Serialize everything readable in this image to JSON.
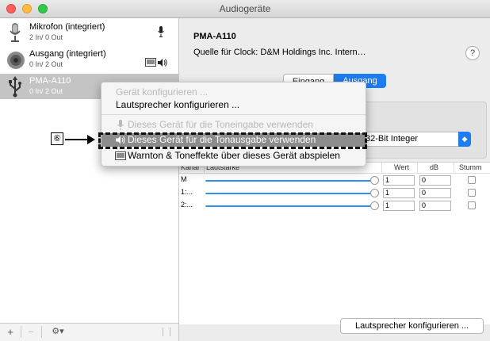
{
  "window": {
    "title": "Audiogeräte"
  },
  "sidebar": {
    "devices": [
      {
        "name": "Mikrofon (integriert)",
        "sub": "2 In/ 0 Out",
        "icon": "microphone-icon"
      },
      {
        "name": "Ausgang (integriert)",
        "sub": "0 In/ 2 Out",
        "icon": "speaker-icon"
      },
      {
        "name": "PMA-A110",
        "sub": "0 In/ 2 Out",
        "icon": "usb-icon"
      }
    ],
    "toolbar": {
      "add": "+",
      "remove": "−",
      "gear": "⚙▾"
    }
  },
  "detail": {
    "device_title": "PMA-A110",
    "clock_label": "Quelle für Clock:",
    "clock_value": "D&M Holdings Inc. Intern…",
    "help": "?",
    "tabs": {
      "input": "Eingang",
      "output": "Ausgang"
    },
    "format_value": "32-Bit Integer",
    "table": {
      "headers": {
        "channel": "Kanal",
        "volume": "Lautstärke",
        "value": "Wert",
        "db": "dB",
        "mute": "Stumm"
      },
      "rows": [
        {
          "channel": "M",
          "value": "1",
          "db": "0",
          "level": 1.0
        },
        {
          "channel": "1:...",
          "value": "1",
          "db": "0",
          "level": 1.0
        },
        {
          "channel": "2:...",
          "value": "1",
          "db": "0",
          "level": 1.0
        }
      ]
    },
    "configure_button": "Lautsprecher konfigurieren ..."
  },
  "context_menu": {
    "items": [
      {
        "label": "Gerät konfigurieren ...",
        "enabled": false
      },
      {
        "label": "Lautsprecher konfigurieren ...",
        "enabled": true
      },
      {
        "label": "Dieses Gerät für die Toneingabe verwenden",
        "enabled": false,
        "icon": "microphone-icon"
      },
      {
        "label": "Dieses Gerät für die Tonausgabe verwenden",
        "enabled": true,
        "highlighted": true,
        "icon": "speaker-icon"
      },
      {
        "label": "Warnton & Toneffekte über dieses Gerät abspielen",
        "enabled": true,
        "icon": "alert-speaker-icon"
      }
    ]
  },
  "annotation": {
    "callout_number": "⑥"
  },
  "colors": {
    "accent": "#1d7cf2",
    "selection_gray": "#c4c4c4",
    "menu_highlight": "#8c8c8c"
  }
}
